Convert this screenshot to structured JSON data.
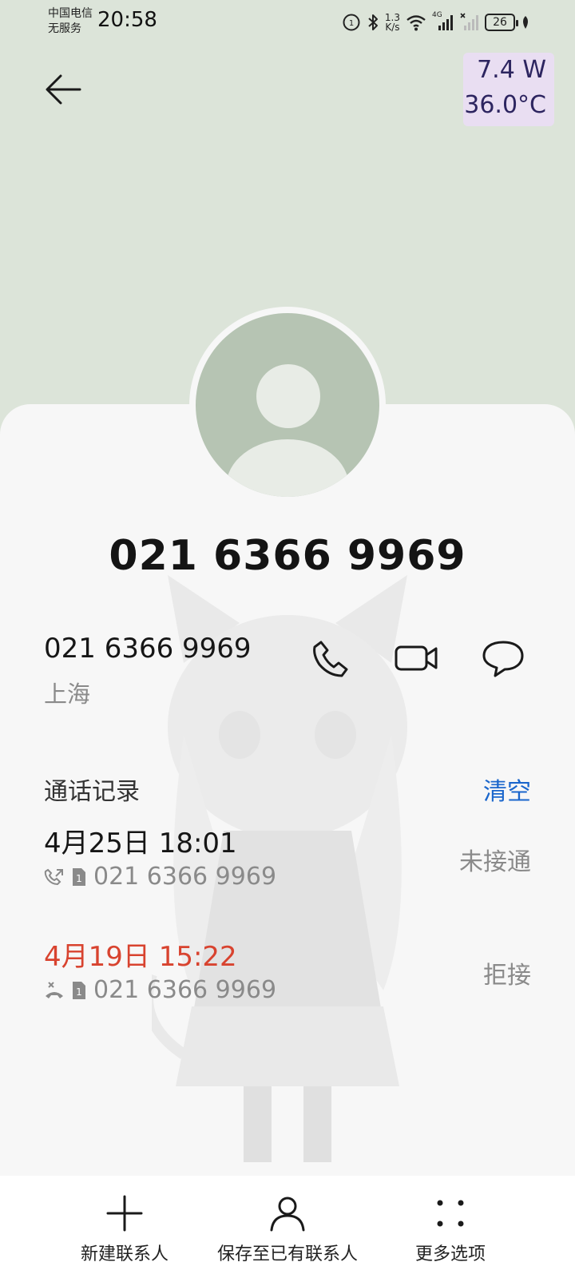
{
  "status_bar": {
    "carrier_line1": "中国电信",
    "carrier_line2": "无服务",
    "time": "20:58",
    "net_speed_value": "1.3",
    "net_speed_unit": "K/s",
    "signal_label": "4G",
    "battery": "26"
  },
  "overlay": {
    "power": "7.4 W",
    "temperature": "36.0°C"
  },
  "contact": {
    "title_number": "021 6366 9969",
    "number": "021 6366 9969",
    "location": "上海"
  },
  "actions": [
    {
      "icon": "phone-icon"
    },
    {
      "icon": "video-call-icon"
    },
    {
      "icon": "message-icon"
    }
  ],
  "call_log": {
    "title": "通话记录",
    "clear_label": "清空",
    "entries": [
      {
        "time": "4月25日 18:01",
        "number": "021 6366 9969",
        "status": "未接通",
        "time_color": "#161616"
      },
      {
        "time": "4月19日 15:22",
        "number": "021 6366 9969",
        "status": "拒接",
        "time_color": "#d8432f"
      }
    ]
  },
  "bottom_bar": [
    {
      "label": "新建联系人",
      "icon": "plus-icon"
    },
    {
      "label": "保存至已有联系人",
      "icon": "person-icon"
    },
    {
      "label": "更多选项",
      "icon": "more-options-icon"
    }
  ],
  "colors": {
    "header_bg": "#dce4d9",
    "card_bg": "#f7f7f7",
    "accent_blue": "#1a66cc",
    "rejected_red": "#d8432f",
    "avatar_bg": "#b6c4b3",
    "overlay_bg": "#e9def2"
  }
}
